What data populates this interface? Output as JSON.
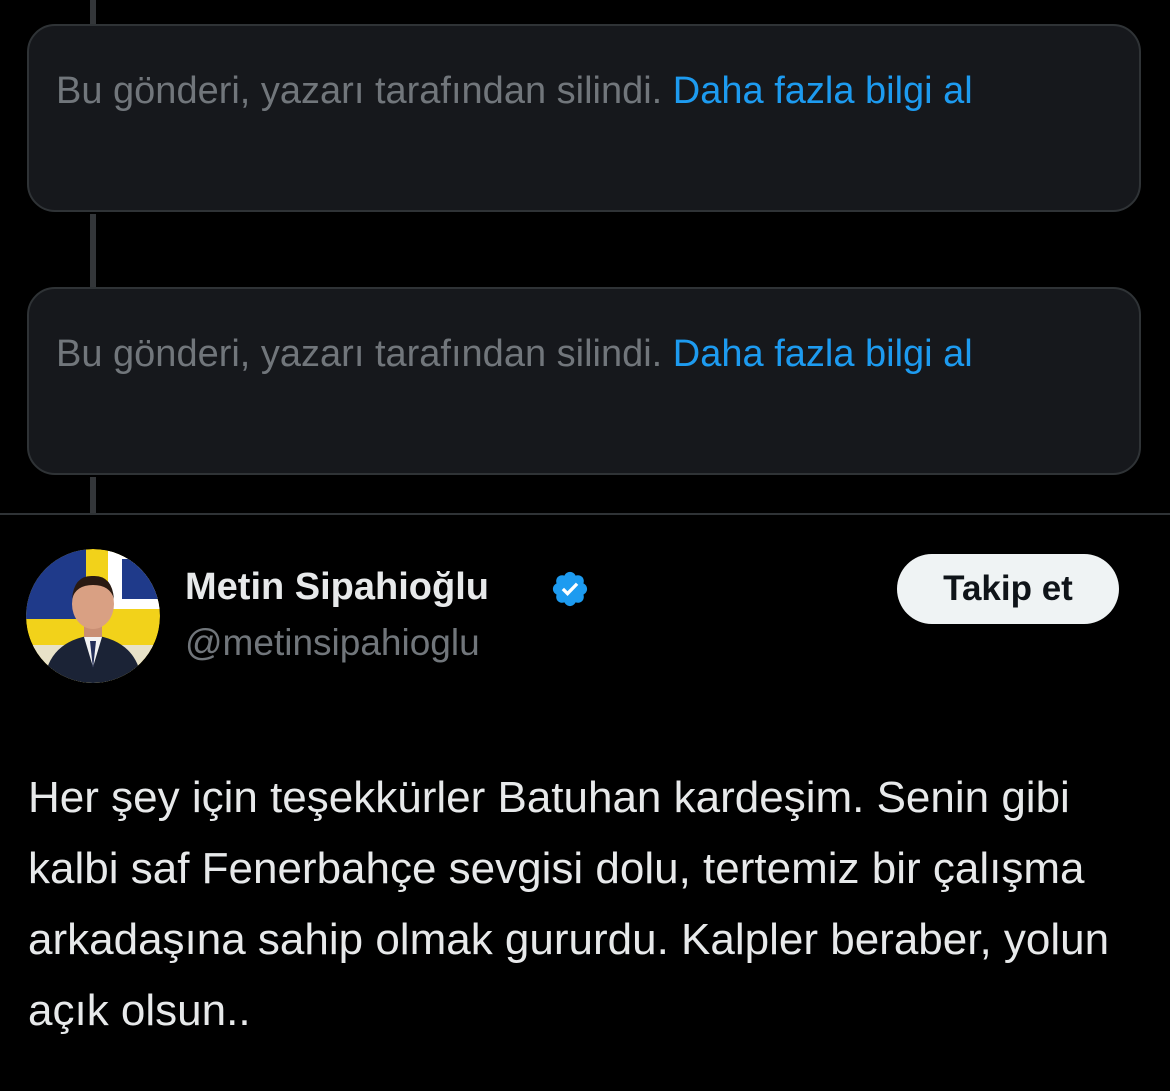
{
  "deleted_posts": [
    {
      "message": "Bu gönderi, yazarı tarafından silindi. ",
      "link_label": "Daha fazla bilgi al"
    },
    {
      "message": "Bu gönderi, yazarı tarafından silindi. ",
      "link_label": "Daha fazla bilgi al"
    }
  ],
  "post": {
    "author_name": "Metin Sipahioğlu",
    "author_handle": "@metinsipahioglu",
    "verified_icon": "verified-badge-icon",
    "follow_label": "Takip et",
    "text": "Her şey için teşekkürler Batuhan kardeşim. Senin gibi kalbi saf Fenerbahçe sevgisi dolu, tertemiz bir çalışma arkadaşına sahip olmak gururdu. Kalpler beraber, yolun açık olsun.."
  },
  "colors": {
    "background": "#000000",
    "card_background": "#16181c",
    "card_border": "#2f3336",
    "muted_text": "#71767b",
    "link": "#1d9bf0",
    "primary_text": "#e7e9ea",
    "verified": "#1d9bf0"
  }
}
